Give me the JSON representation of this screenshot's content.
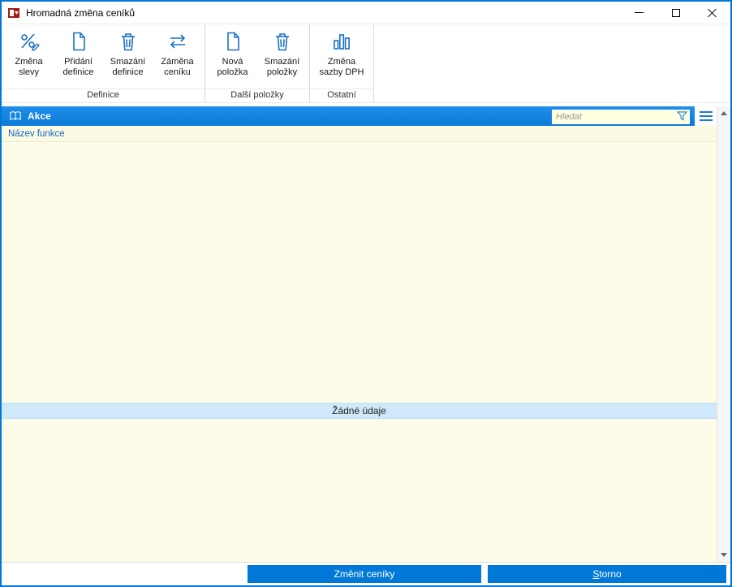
{
  "window": {
    "title": "Hromadná změna ceníků"
  },
  "toolbar": {
    "groups": [
      {
        "label": "Definice",
        "buttons": [
          {
            "label": "Změna\nslevy",
            "icon": "discount-edit-icon"
          },
          {
            "label": "Přidání\ndefinice",
            "icon": "document-icon"
          },
          {
            "label": "Smazání\ndefinice",
            "icon": "trash-icon"
          },
          {
            "label": "Záměna\nceníku",
            "icon": "swap-arrows-icon"
          }
        ]
      },
      {
        "label": "Další položky",
        "buttons": [
          {
            "label": "Nová\npoložka",
            "icon": "document-icon"
          },
          {
            "label": "Smazání\npoložky",
            "icon": "trash-icon"
          }
        ]
      },
      {
        "label": "Ostatní",
        "buttons": [
          {
            "label": "Změna\nsazby DPH",
            "icon": "bar-chart-icon"
          }
        ]
      }
    ]
  },
  "panel": {
    "title": "Akce",
    "search": {
      "placeholder": "Hledat"
    },
    "column_header": "Název funkce",
    "empty_message": "Žádné údaje"
  },
  "footer": {
    "apply": "Změnit ceníky",
    "cancel_accel": "S",
    "cancel_rest": "torno"
  },
  "colors": {
    "accent": "#0078d7",
    "panel_header_blue": "#0f82e6",
    "content_bg": "#fcfce8",
    "search_bg": "#ffffe1",
    "empty_band_bg": "#cfe9fb",
    "icon_blue": "#1a6fc4"
  }
}
